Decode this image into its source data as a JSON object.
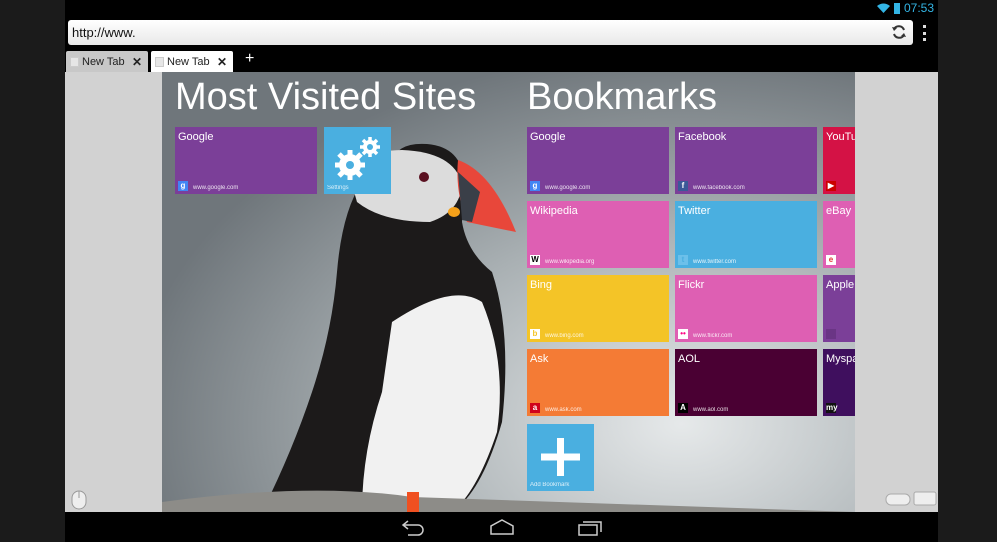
{
  "status_bar": {
    "time": "07:53",
    "icons": [
      "wifi-icon",
      "battery-icon"
    ]
  },
  "browser": {
    "url": "http://www.",
    "tabs": [
      {
        "label": "New Tab",
        "active": false
      },
      {
        "label": "New Tab",
        "active": true
      }
    ],
    "new_tab_label": "+"
  },
  "most_visited": {
    "heading": "Most Visited Sites",
    "tiles": [
      {
        "title": "Google",
        "url": "www.google.com",
        "color": "#7b3f98"
      }
    ],
    "settings_label": "Settings",
    "settings_color": "#4aafe0"
  },
  "bookmarks": {
    "heading": "Bookmarks",
    "tiles": [
      {
        "title": "Google",
        "url": "www.google.com",
        "color": "#7b3f98",
        "icon": "google-icon"
      },
      {
        "title": "Facebook",
        "url": "www.facebook.com",
        "color": "#7b3f98",
        "icon": "facebook-icon"
      },
      {
        "title": "YouTube",
        "url": "",
        "color": "#d41245",
        "icon": "youtube-icon"
      },
      {
        "title": "Wikipedia",
        "url": "www.wikipedia.org",
        "color": "#de5fb3",
        "icon": "wikipedia-icon"
      },
      {
        "title": "Twitter",
        "url": "www.twitter.com",
        "color": "#4aafe0",
        "icon": "twitter-icon"
      },
      {
        "title": "eBay",
        "url": "",
        "color": "#de5fb3",
        "icon": "ebay-icon"
      },
      {
        "title": "Bing",
        "url": "www.bing.com",
        "color": "#f4c427",
        "icon": "bing-icon"
      },
      {
        "title": "Flickr",
        "url": "www.flickr.com",
        "color": "#de5fb3",
        "icon": "flickr-icon"
      },
      {
        "title": "Apple",
        "url": "",
        "color": "#7b3f98",
        "icon": "apple-icon"
      },
      {
        "title": "Ask",
        "url": "www.ask.com",
        "color": "#f47b35",
        "icon": "ask-icon"
      },
      {
        "title": "AOL",
        "url": "www.aol.com",
        "color": "#4a0033",
        "icon": "aol-icon"
      },
      {
        "title": "Myspace",
        "url": "",
        "color": "#3f0f5e",
        "icon": "myspace-icon"
      }
    ],
    "add_label": "Add Bookmark",
    "add_color": "#4aafe0"
  }
}
